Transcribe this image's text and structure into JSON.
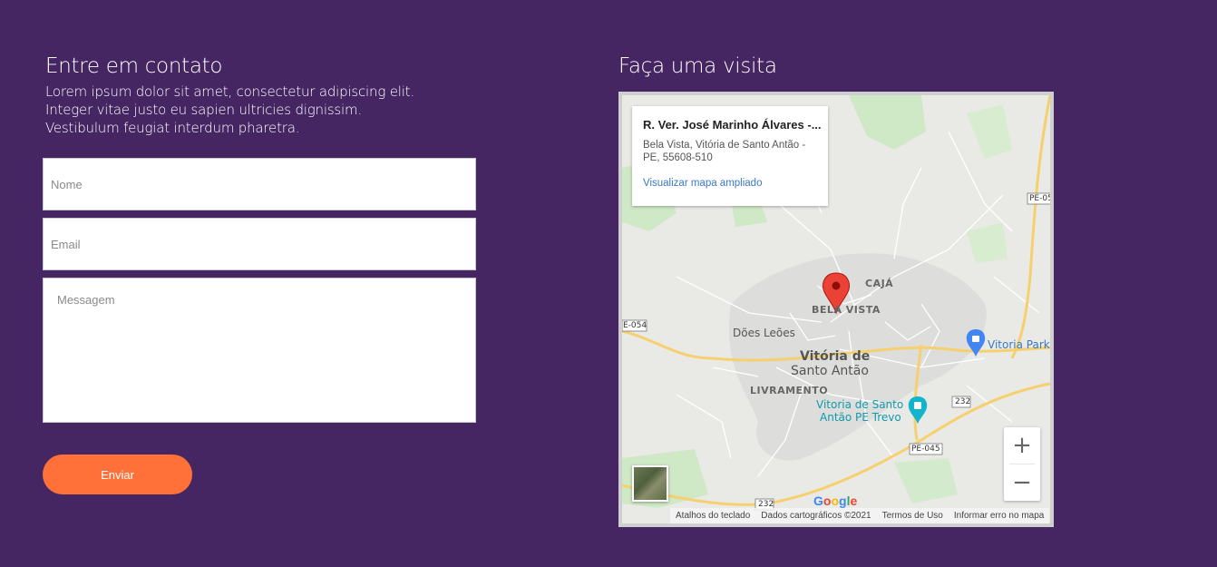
{
  "contact": {
    "title": "Entre em contato",
    "description_lines": [
      "Lorem ipsum dolor sit amet, consectetur adipiscing elit.",
      "Integer vitae justo eu sapien ultricies dignissim.",
      "Vestibulum feugiat interdum pharetra."
    ],
    "name_placeholder": "Nome",
    "email_placeholder": "Email",
    "message_placeholder": "Messagem",
    "submit_label": "Enviar",
    "submit_color": "#ff7139",
    "background_color": "#462563"
  },
  "visit": {
    "title": "Faça uma visita",
    "map": {
      "info_title": "R. Ver. José Marinho Álvares -...",
      "info_address": "Bela Vista, Vitória de Santo Antão - PE, 55608-510",
      "info_link": "Visualizar mapa ampliado",
      "labels": {
        "caja": "CAJÁ",
        "bela_vista": "BELA VISTA",
        "does_leoes": "Dões Leões",
        "vitoria_line1": "Vitória de",
        "vitoria_line2": "Santo Antão",
        "livramento": "LIVRAMENTO",
        "vitoria_park": "Vitoria Park",
        "trevo_line1": "Vitoria de Santo",
        "trevo_line2": "Antão PE Trevo"
      },
      "road_shields": {
        "pe05": "PE-05",
        "e054": "E-054",
        "r232_a": "232",
        "r232_b": "232",
        "pe045": "PE-045"
      },
      "zoom_in": "+",
      "zoom_out": "−",
      "google_logo": "Google",
      "footer": {
        "shortcuts": "Atalhos do teclado",
        "map_data": "Dados cartográficos ©2021",
        "terms": "Termos de Uso",
        "report": "Informar erro no mapa"
      },
      "icons": {
        "pin": "map-pin-icon",
        "shopping": "shopping-bag-icon",
        "transit": "transit-station-icon"
      }
    }
  }
}
